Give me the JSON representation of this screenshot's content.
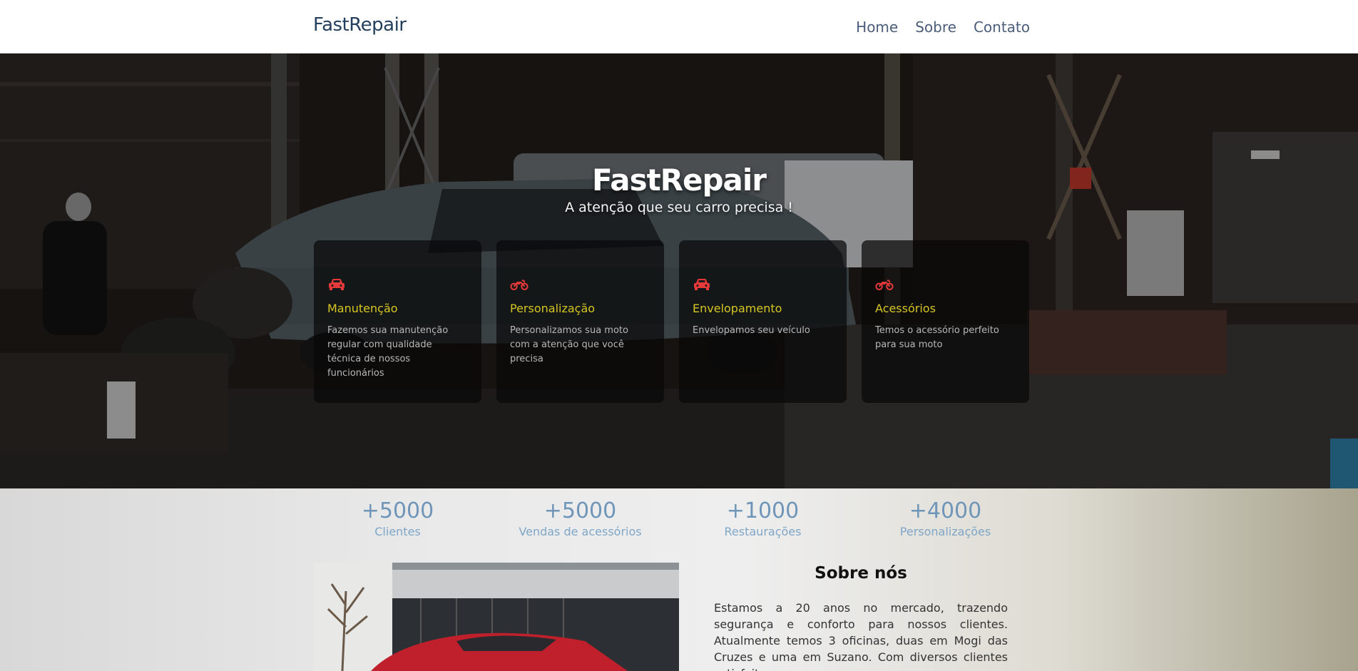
{
  "navbar": {
    "brand": "FastRepair",
    "links": [
      "Home",
      "Sobre",
      "Contato"
    ]
  },
  "hero": {
    "title": "FastRepair",
    "subtitle": "A atenção que seu carro precisa !"
  },
  "services": [
    {
      "icon": "car-icon",
      "title": "Manutenção",
      "text": "Fazemos sua manutenção regular com qualidade técnica de nossos funcionários"
    },
    {
      "icon": "motorcycle-icon",
      "title": "Personalização",
      "text": "Personalizamos sua moto com a atenção que você precisa"
    },
    {
      "icon": "car-icon",
      "title": "Envelopamento",
      "text": "Envelopamos seu veículo"
    },
    {
      "icon": "motorcycle-icon",
      "title": "Acessórios",
      "text": "Temos o acessório perfeito para sua moto"
    }
  ],
  "stats": [
    {
      "value": "+5000",
      "label": "Clientes"
    },
    {
      "value": "+5000",
      "label": "Vendas de acessórios"
    },
    {
      "value": "+1000",
      "label": "Restaurações"
    },
    {
      "value": "+4000",
      "label": "Personalizações"
    }
  ],
  "about": {
    "title": "Sobre nós",
    "text": "Estamos a 20 anos no mercado, trazendo segurança e conforto para nossos clientes. Atualmente temos 3 oficinas, duas em Mogi das Cruzes e uma em Suzano. Com diversos clientes satisfeitos, nossa empresa"
  },
  "colors": {
    "accent_yellow": "#d6c623",
    "icon_red": "#e63a3a",
    "stat_blue": "#6f95b8"
  }
}
